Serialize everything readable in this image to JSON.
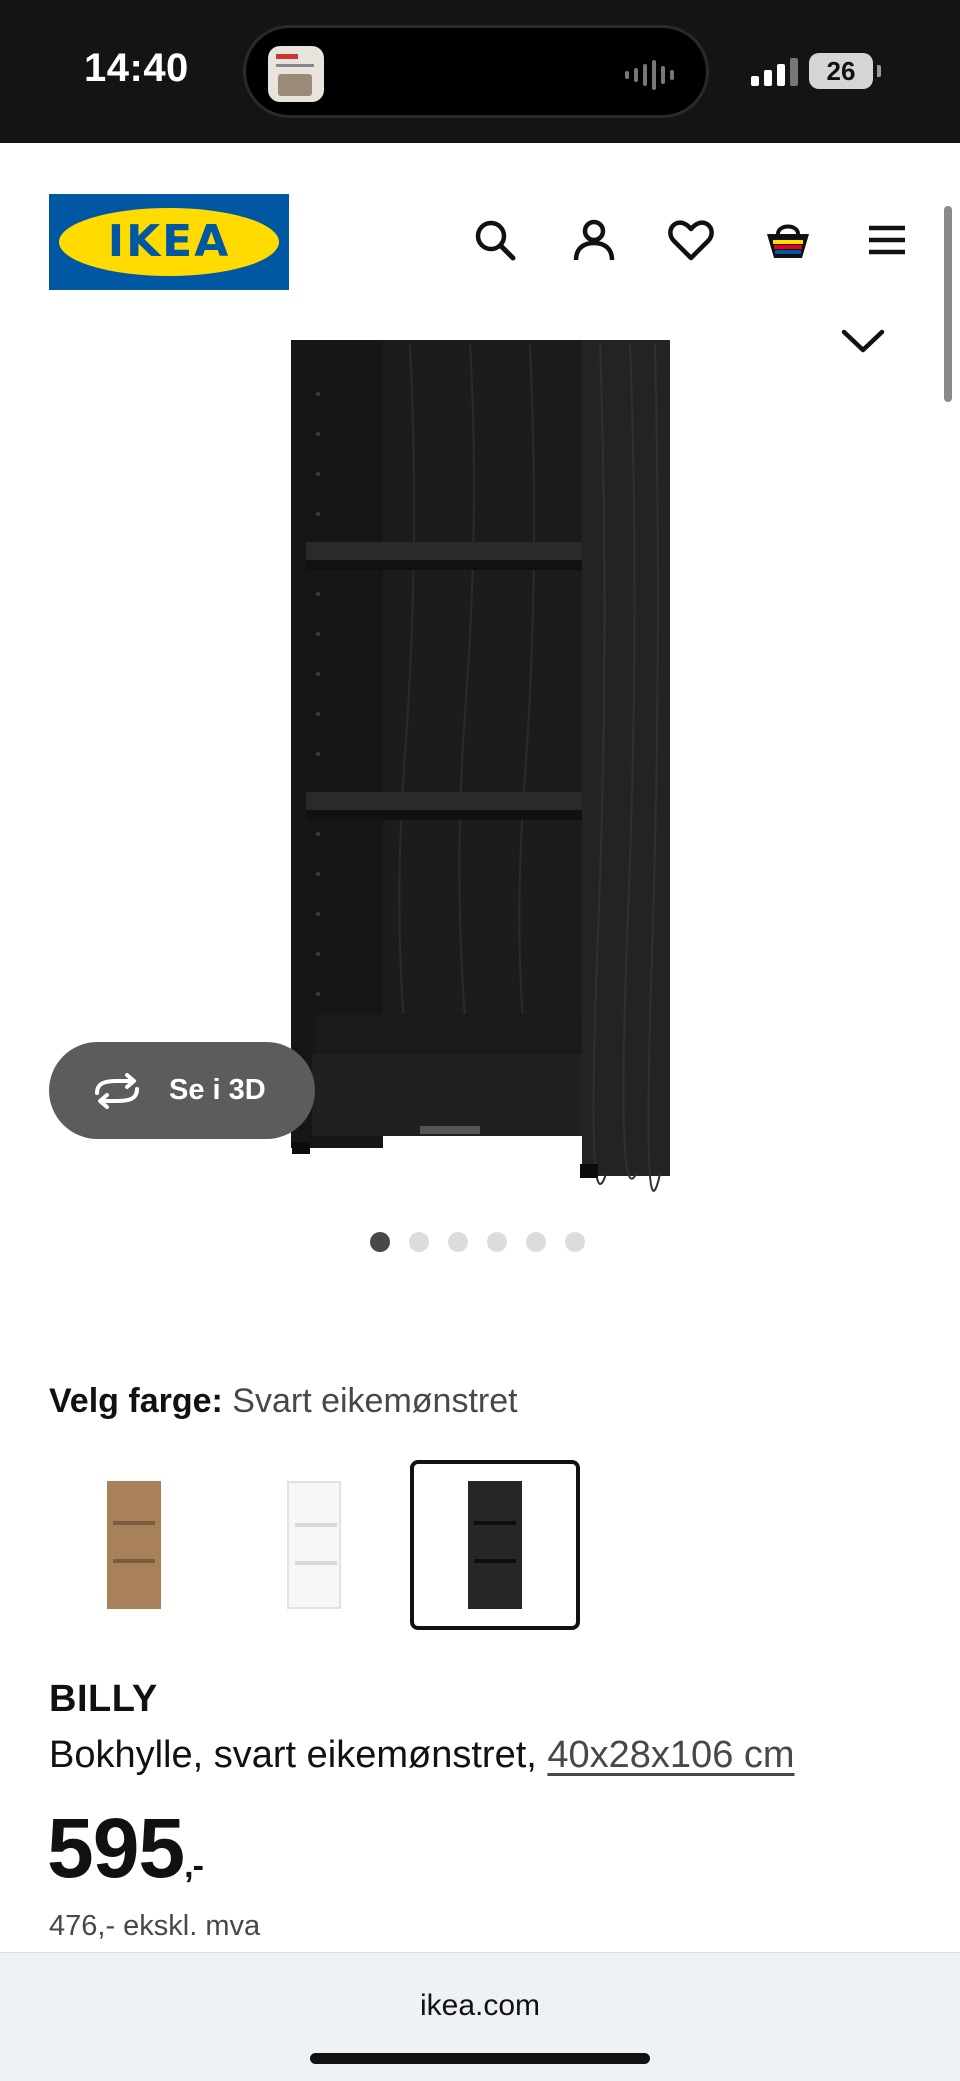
{
  "status_bar": {
    "time": "14:40",
    "battery": "26",
    "icons": [
      "island-thumbnail",
      "audio-wave-icon",
      "signal-icon",
      "battery-icon"
    ]
  },
  "header": {
    "logo_text": "IKEA",
    "icons": [
      "search-icon",
      "account-icon",
      "heart-icon",
      "basket-icon",
      "menu-icon"
    ]
  },
  "gallery": {
    "view_3d_label": "Se i 3D",
    "dot_count": 6,
    "active_dot": 0
  },
  "color_select": {
    "label": "Velg farge:",
    "value": "Svart eikemønstret",
    "swatches": [
      {
        "name": "oak",
        "color": "#a8805a",
        "selected": false
      },
      {
        "name": "white",
        "color": "#f4f4f4",
        "selected": false
      },
      {
        "name": "black-oak",
        "color": "#262626",
        "selected": true
      }
    ]
  },
  "product": {
    "name": "BILLY",
    "description": "Bokhylle, svart eikemønstret,",
    "size": "40x28x106 cm",
    "price": "595",
    "price_suffix": ",-",
    "price_ex_vat": "476,- ekskl. mva"
  },
  "browser": {
    "url": "ikea.com"
  },
  "colors": {
    "ikea_blue": "#0058a3",
    "ikea_yellow": "#ffdb00",
    "shelf_dark": "#1f1f1f"
  }
}
